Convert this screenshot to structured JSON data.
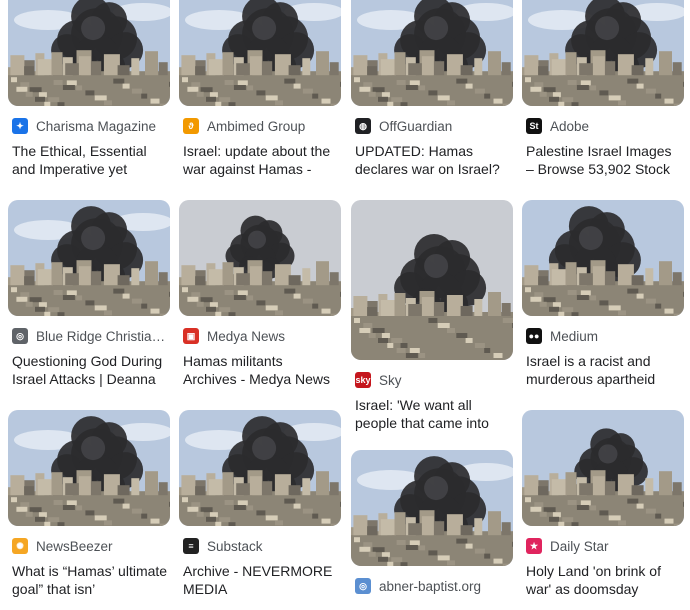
{
  "results": [
    {
      "source": "Charisma Magazine",
      "favicon": "charisma-icon",
      "favicon_color": "#1a73e8",
      "title": "The Ethical, Essential and Imperative yet"
    },
    {
      "source": "Ambimed Group",
      "favicon": "ambimed-icon",
      "favicon_color": "#f29900",
      "title": "Israel: update about the war against Hamas -"
    },
    {
      "source": "OffGuardian",
      "favicon": "offguardian-icon",
      "favicon_color": "#202124",
      "title": "UPDATED: Hamas declares war on Israel?"
    },
    {
      "source": "Adobe",
      "favicon": "adobe-stock-icon",
      "favicon_color": "#111111",
      "title": "Palestine Israel Images – Browse 53,902 Stock"
    },
    {
      "source": "Blue Ridge Christian...",
      "favicon": "globe-icon",
      "favicon_color": "#5f6368",
      "title": "Questioning God During Israel Attacks | Deanna"
    },
    {
      "source": "Medya News",
      "favicon": "medya-icon",
      "favicon_color": "#d93025",
      "title": "Hamas militants Archives - Medya News"
    },
    {
      "source": "Sky",
      "favicon": "sky-news-icon",
      "favicon_color": "#c5161d",
      "title": "Israel: 'We want all people that came into"
    },
    {
      "source": "Medium",
      "favicon": "medium-icon",
      "favicon_color": "#111111",
      "title": "Israel is a racist and murderous apartheid"
    },
    {
      "source": "NewsBeezer",
      "favicon": "newsbeezer-icon",
      "favicon_color": "#f5a623",
      "title": "What is “Hamas’ ultimate goal” that isn’"
    },
    {
      "source": "Substack",
      "favicon": "substack-icon",
      "favicon_color": "#222222",
      "title": "Archive - NEVERMORE MEDIA"
    },
    {
      "source": "abner-baptist.org",
      "favicon": "globe-icon",
      "favicon_color": "#5b8fd1",
      "title": ""
    },
    {
      "source": "Daily Star",
      "favicon": "daily-star-icon",
      "favicon_color": "#e0245e",
      "title": "Holy Land 'on brink of war' as doomsday"
    }
  ]
}
